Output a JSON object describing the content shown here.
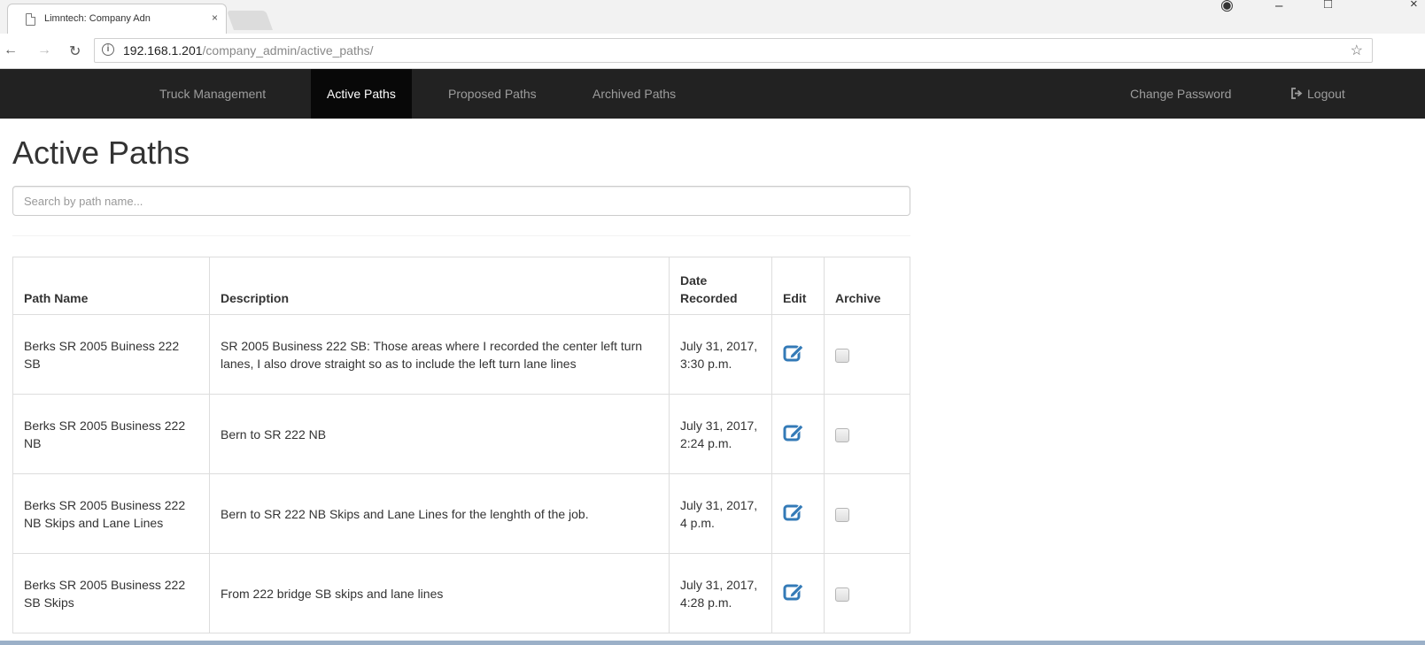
{
  "browser": {
    "tab_title": "Limntech: Company Adn",
    "tab_close": "×",
    "url_host": "192.168.1.201",
    "url_path": "/company_admin/active_paths/"
  },
  "navbar": {
    "items": [
      {
        "label": "Truck Management"
      },
      {
        "label": "Active Paths"
      },
      {
        "label": "Proposed Paths"
      },
      {
        "label": "Archived Paths"
      }
    ],
    "right": {
      "change_password": "Change Password",
      "logout": "Logout"
    }
  },
  "page": {
    "title": "Active Paths",
    "search_placeholder": "Search by path name..."
  },
  "table": {
    "headers": {
      "path_name": "Path Name",
      "description": "Description",
      "date_recorded": "Date Recorded",
      "edit": "Edit",
      "archive": "Archive"
    },
    "rows": [
      {
        "path_name": "Berks SR 2005 Buiness 222 SB",
        "description": "SR 2005 Business 222 SB: Those areas where I recorded the center left turn lanes, I also drove straight so as to include the left turn lane lines",
        "date": "July 31, 2017, 3:30 p.m.",
        "archived": false
      },
      {
        "path_name": "Berks SR 2005 Business 222 NB",
        "description": "Bern to SR 222 NB",
        "date": "July 31, 2017, 2:24 p.m.",
        "archived": false
      },
      {
        "path_name": "Berks SR 2005 Business 222 NB Skips and Lane Lines",
        "description": "Bern to SR 222 NB Skips and Lane Lines for the lenghth of the job.",
        "date": "July 31, 2017, 4 p.m.",
        "archived": false
      },
      {
        "path_name": "Berks SR 2005 Business 222 SB Skips",
        "description": "From 222 bridge SB skips and lane lines",
        "date": "July 31, 2017, 4:28 p.m.",
        "archived": false
      }
    ]
  },
  "colors": {
    "navbar_bg": "#222222",
    "navbar_active_bg": "#080808",
    "edit_icon": "#337ab7"
  }
}
